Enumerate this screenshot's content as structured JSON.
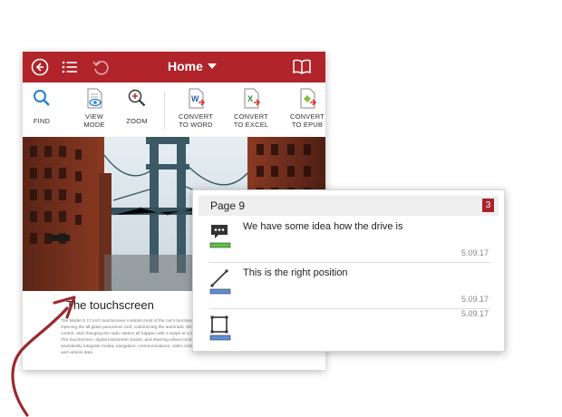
{
  "app": {
    "title": "Home"
  },
  "toolbar": {
    "tools": [
      {
        "label_1": "FIND",
        "label_2": ""
      },
      {
        "label_1": "VIEW",
        "label_2": "MODE"
      },
      {
        "label_1": "ZOOM",
        "label_2": ""
      },
      {
        "label_1": "CONVERT",
        "label_2": "TO WORD"
      },
      {
        "label_1": "CONVERT",
        "label_2": "TO EXCEL"
      },
      {
        "label_1": "CONVERT",
        "label_2": "TO EPUB"
      }
    ]
  },
  "document": {
    "heading": "The touchscreen",
    "body": "The Model S 17 inch touchscreen controls most of the car's functions. Opening the all glass panoramic roof, customizing the automatic climate control, and changing the radio station all happen with a swipe or a touch. The touchscreen, digital instrument cluster, and steering wheel controls seamlessly integrate media, navigation, communications, cabin controls and vehicle data."
  },
  "annotations_panel": {
    "page_label": "Page 9",
    "count": "3",
    "items": [
      {
        "type": "comment",
        "text": "We have some idea how the drive is",
        "date": "5.09.17",
        "color": "#5cc23b"
      },
      {
        "type": "line",
        "text": "This is the right position",
        "date": "5.09.17",
        "color": "#5b8fd6"
      },
      {
        "type": "rectangle",
        "text": "",
        "date": "5.09.17",
        "color": "#5b8fd6"
      }
    ]
  },
  "colors": {
    "brand": "#b0242a",
    "arrow": "#9a2a2e"
  },
  "icons": [
    "back-icon",
    "list-icon",
    "undo-icon",
    "book-icon",
    "search-icon",
    "view-mode-icon",
    "zoom-icon",
    "word-file-icon",
    "excel-file-icon",
    "epub-file-icon",
    "comment-icon",
    "line-icon",
    "rectangle-icon"
  ]
}
